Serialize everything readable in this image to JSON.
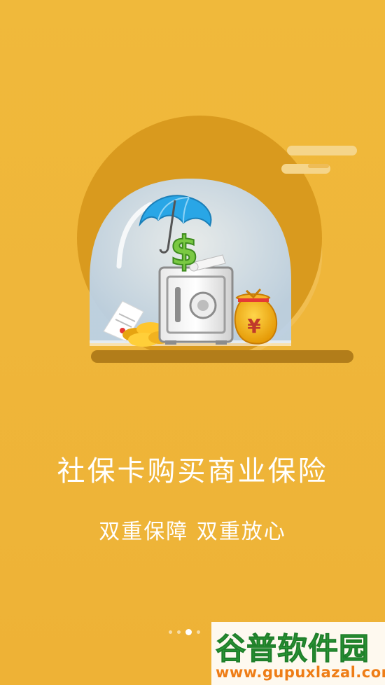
{
  "slide": {
    "headline": "社保卡购买商业保险",
    "subheadline": "双重保障  双重放心"
  },
  "pager": {
    "total": 4,
    "active_index": 2
  },
  "watermark": {
    "title": "谷普软件园",
    "url": "www.gupuxlazal.com"
  },
  "colors": {
    "background": "#efb63a",
    "circle": "#d99a1e",
    "shadow": "#b27d1a",
    "text": "#ffffff",
    "watermark_green": "#2ea03a",
    "watermark_orange": "#ee7d16"
  }
}
